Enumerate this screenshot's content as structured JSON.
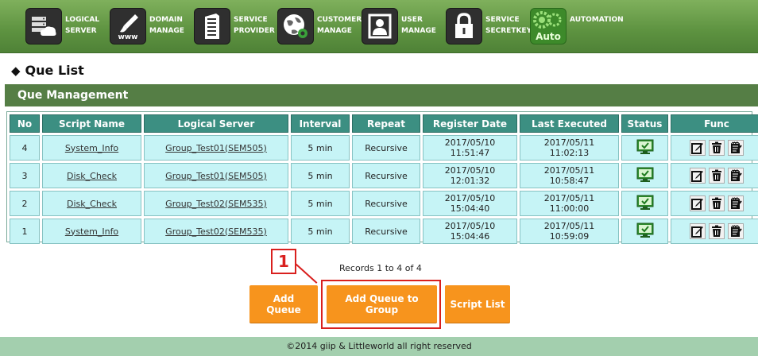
{
  "nav": [
    {
      "label": "LOGICAL\nSERVER",
      "icon": "server-cloud-icon"
    },
    {
      "label": "DOMAIN\nMANAGE",
      "icon": "www-brush-icon"
    },
    {
      "label": "SERVICE\nPROVIDER",
      "icon": "building-icon"
    },
    {
      "label": "CUSTOMER\nMANAGE",
      "icon": "globe-gear-icon"
    },
    {
      "label": "USER\nMANAGE",
      "icon": "user-portrait-icon"
    },
    {
      "label": "SERVICE\nSECRETKEY",
      "icon": "padlock-icon"
    },
    {
      "label": "AUTOMATION",
      "icon": "auto-gears-icon",
      "sublabel": "Auto"
    }
  ],
  "page": {
    "title": "Que List",
    "section": "Que Management"
  },
  "table": {
    "headers": [
      "No",
      "Script Name",
      "Logical Server",
      "Interval",
      "Repeat",
      "Register Date",
      "Last Executed",
      "Status",
      "Func"
    ],
    "rows": [
      {
        "no": "4",
        "script": "System_Info",
        "server": "Group_Test01(SEM505)",
        "interval": "5 min",
        "repeat": "Recursive",
        "reg_date": "2017/05/10",
        "reg_time": "11:51:47",
        "exec_date": "2017/05/11",
        "exec_time": "11:02:13"
      },
      {
        "no": "3",
        "script": "Disk_Check",
        "server": "Group_Test01(SEM505)",
        "interval": "5 min",
        "repeat": "Recursive",
        "reg_date": "2017/05/10",
        "reg_time": "12:01:32",
        "exec_date": "2017/05/11",
        "exec_time": "10:58:47"
      },
      {
        "no": "2",
        "script": "Disk_Check",
        "server": "Group_Test02(SEM535)",
        "interval": "5 min",
        "repeat": "Recursive",
        "reg_date": "2017/05/10",
        "reg_time": "15:04:40",
        "exec_date": "2017/05/11",
        "exec_time": "11:00:00"
      },
      {
        "no": "1",
        "script": "System_Info",
        "server": "Group_Test02(SEM535)",
        "interval": "5 min",
        "repeat": "Recursive",
        "reg_date": "2017/05/10",
        "reg_time": "15:04:46",
        "exec_date": "2017/05/11",
        "exec_time": "10:59:09"
      }
    ]
  },
  "records": "Records 1 to 4 of 4",
  "buttons": {
    "add_queue": "Add Queue",
    "add_queue_group": "Add Queue to Group",
    "script_list": "Script List"
  },
  "callout": "1",
  "footer": "©2014 giip & Littleworld all right reserved",
  "colors": {
    "nav_green": "#5d9240",
    "section_bar": "#557e45",
    "header_teal": "#3c8f82",
    "cell_cyan": "#c6f4f6",
    "button_orange": "#f7941d",
    "callout_red": "#d9201e",
    "footer_green": "#a3cfae"
  }
}
